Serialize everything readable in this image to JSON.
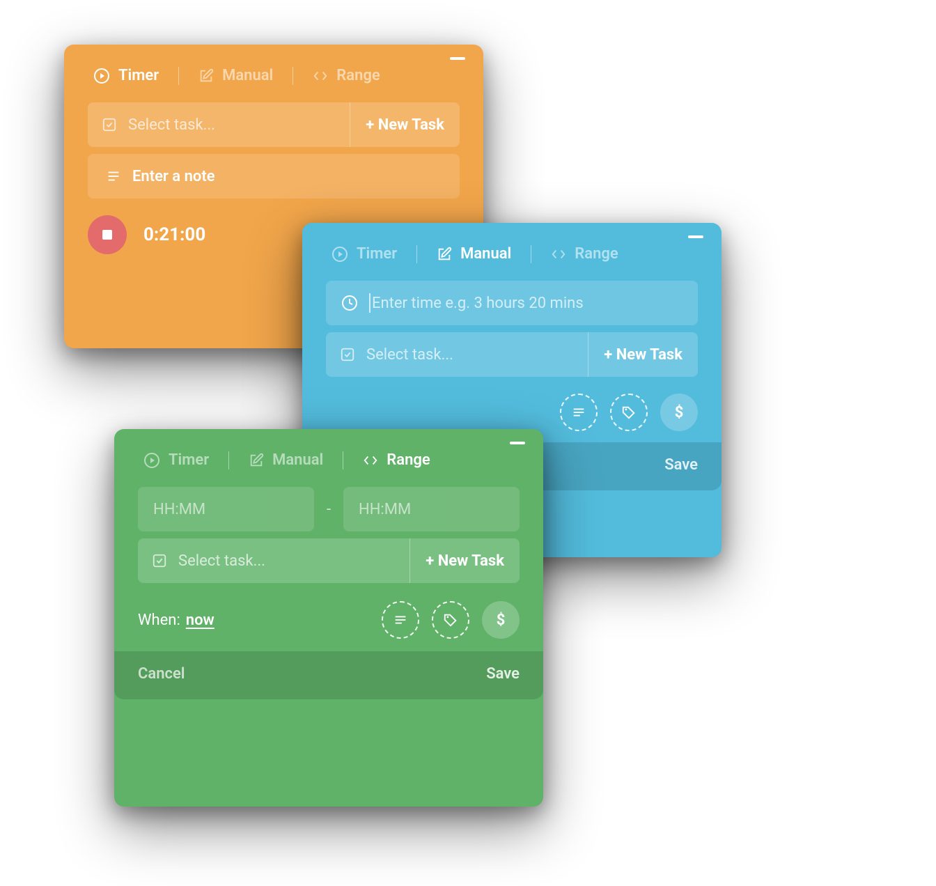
{
  "tabs": {
    "timer": "Timer",
    "manual": "Manual",
    "range": "Range"
  },
  "common": {
    "select_task": "Select task...",
    "new_task": "+ New Task",
    "save": "Save",
    "cancel": "Cancel"
  },
  "orange": {
    "note_placeholder": "Enter a note",
    "elapsed": "0:21:00"
  },
  "blue": {
    "time_placeholder": "Enter time e.g. 3 hours 20 mins"
  },
  "green": {
    "hh_mm": "HH:MM",
    "range_sep": "-",
    "when_label": "When:",
    "when_value": "now"
  },
  "icons": {
    "dollar": "$"
  },
  "colors": {
    "orange": "#f2a64b",
    "blue": "#53bcdd",
    "green": "#5fb268",
    "stop": "#e46b6b"
  }
}
